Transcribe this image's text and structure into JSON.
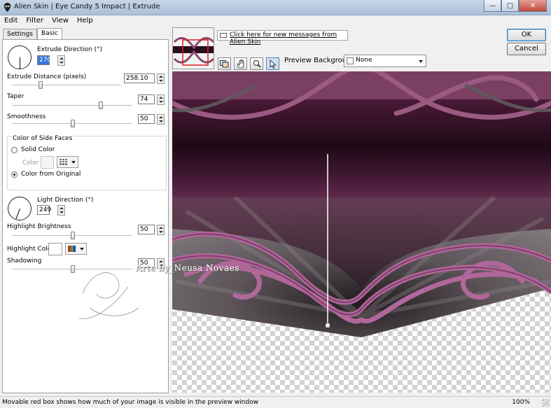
{
  "window": {
    "title": "Alien Skin | Eye Candy 5 Impact | Extrude"
  },
  "menu": [
    "Edit",
    "Filter",
    "View",
    "Help"
  ],
  "tabs": [
    "Settings",
    "Basic"
  ],
  "basic": {
    "extrude_direction": {
      "label": "Extrude Direction (°)",
      "value": "270"
    },
    "extrude_distance": {
      "label": "Extrude Distance (pixels)",
      "value": "258.10"
    },
    "taper": {
      "label": "Taper",
      "value": "74"
    },
    "smoothness": {
      "label": "Smoothness",
      "value": "50"
    },
    "side_faces": {
      "title": "Color of Side Faces",
      "solid_color": "Solid Color",
      "color_label": "Color",
      "from_original": "Color from Original",
      "selected": "Color from Original"
    },
    "light_direction": {
      "label": "Light Direction (°)",
      "value": "249"
    },
    "highlight_brightness": {
      "label": "Highlight Brightness",
      "value": "50"
    },
    "highlight_color": {
      "label": "Highlight Color",
      "color": "#ffffff"
    },
    "shadowing": {
      "label": "Shadowing",
      "value": "50"
    }
  },
  "watermark": {
    "text": "Arte by_Neusa Novaes"
  },
  "preview": {
    "message_link": "Click here for new messages from Alien Skin",
    "background_label": "Preview Background:",
    "background_value": "None",
    "tools": [
      "preview-toggle-icon",
      "hand-icon",
      "zoom-icon",
      "pointer-icon"
    ],
    "colors": {
      "plum": "#6e2d52",
      "plum_dark": "#2a0c1e",
      "gray": "#6a6468"
    }
  },
  "buttons": {
    "ok": "OK",
    "cancel": "Cancel"
  },
  "status": {
    "text": "Movable red box shows how much of your image is visible in the preview window",
    "zoom": "100%"
  }
}
